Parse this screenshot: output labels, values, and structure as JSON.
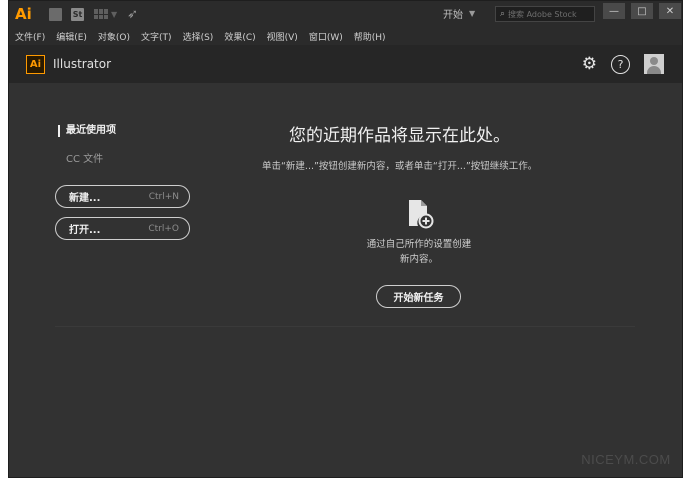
{
  "titlebar": {
    "app_logo": "Ai",
    "st_badge": "St",
    "workspace_label": "开始",
    "stock_placeholder": "搜索 Adobe Stock",
    "icons": [
      "bridge-icon",
      "stock-icon",
      "arrange-documents-icon",
      "gpu-rocket-icon",
      "search-icon"
    ],
    "window_controls": [
      "—",
      "□",
      "✕"
    ]
  },
  "menubar": {
    "items": [
      "文件(F)",
      "编辑(E)",
      "对象(O)",
      "文字(T)",
      "选择(S)",
      "效果(C)",
      "视图(V)",
      "窗口(W)",
      "帮助(H)"
    ]
  },
  "home": {
    "logo": "Ai",
    "title": "Illustrator",
    "icons": [
      "gear-icon",
      "help-icon",
      "user-avatar-icon"
    ],
    "help_glyph": "?"
  },
  "sidebar": {
    "recent_label": "最近使用项",
    "cc_files_label": "CC 文件",
    "new_button": {
      "label": "新建...",
      "shortcut": "Ctrl+N"
    },
    "open_button": {
      "label": "打开...",
      "shortcut": "Ctrl+O"
    }
  },
  "main": {
    "title": "您的近期作品将显示在此处。",
    "subtitle": "单击“新建...”按钮创建新内容，或者单击“打开...”按钮继续工作。",
    "create_desc_line1": "通过自己所作的设置创建",
    "create_desc_line2": "新内容。",
    "start_button": "开始新任务"
  },
  "watermark": "NICEYM.COM",
  "colors": {
    "accent_orange": "#ff9a00",
    "background": "#323232",
    "header": "#262626"
  }
}
